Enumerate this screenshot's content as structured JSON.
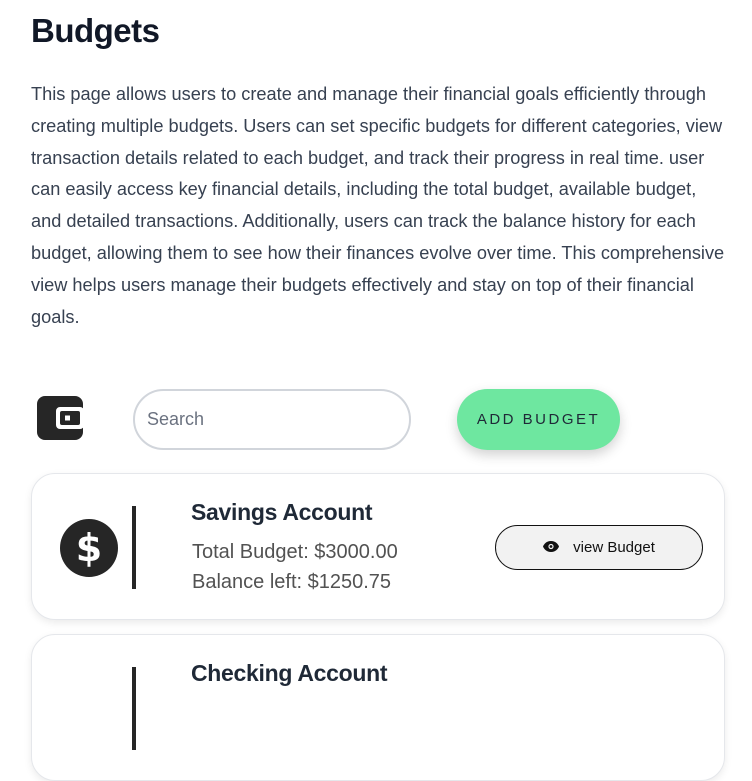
{
  "page": {
    "title": "Budgets",
    "description": "This page allows users to create and manage their financial goals efficiently through creating multiple budgets. Users can set specific budgets for different categories, view transaction details related to each budget, and track their progress in real time. user can easily access key financial details, including the total budget, available budget, and detailed transactions. Additionally, users can track the balance history for each budget, allowing them to see how their finances evolve over time. This comprehensive view helps users manage their budgets effectively and stay on top of their financial goals."
  },
  "toolbar": {
    "icon": "wallet-icon",
    "search_placeholder": "Search",
    "search_value": "",
    "add_label": "ADD BUDGET",
    "add_color": "#6ee7a0"
  },
  "budgets": [
    {
      "name": "Savings Account",
      "icon": "dollar-icon",
      "total": "Total Budget: $3000.00",
      "balance": "Balance left: $1250.75",
      "view_label": "view Budget"
    },
    {
      "name": "Checking Account"
    }
  ]
}
